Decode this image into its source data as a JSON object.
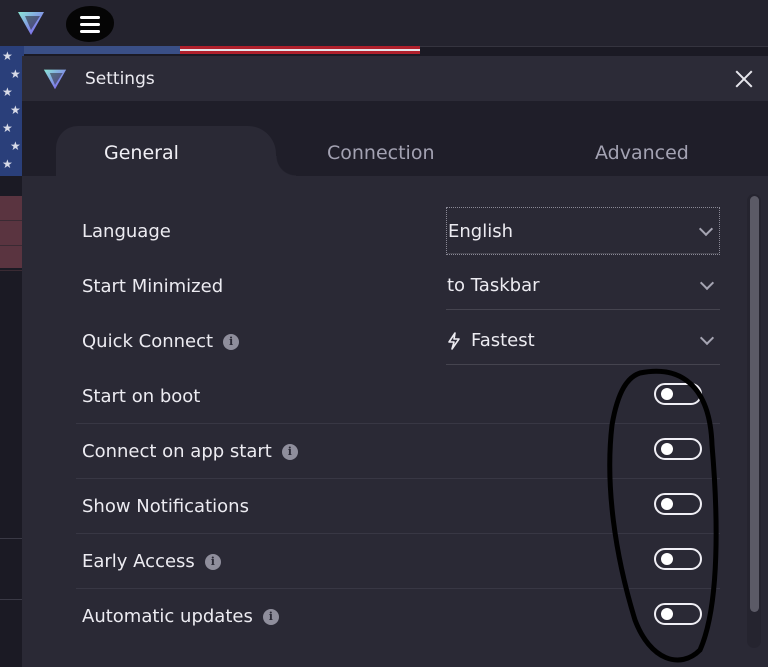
{
  "dialog": {
    "title": "Settings",
    "close_label": "×"
  },
  "tabs": [
    {
      "label": "General",
      "active": true
    },
    {
      "label": "Connection",
      "active": false
    },
    {
      "label": "Advanced",
      "active": false
    }
  ],
  "selects": {
    "language": {
      "label": "Language",
      "value": "English"
    },
    "start_minimized": {
      "label": "Start Minimized",
      "value": "to Taskbar"
    },
    "quick_connect": {
      "label": "Quick Connect",
      "value": "Fastest",
      "has_info": true,
      "value_icon": "lightning-icon"
    }
  },
  "toggles": [
    {
      "label": "Start on boot",
      "on": false,
      "has_info": false
    },
    {
      "label": "Connect on app start",
      "on": false,
      "has_info": true
    },
    {
      "label": "Show Notifications",
      "on": false,
      "has_info": false
    },
    {
      "label": "Early Access",
      "on": false,
      "has_info": true
    },
    {
      "label": "Automatic updates",
      "on": false,
      "has_info": true
    }
  ],
  "colors": {
    "dialog_bg": "#2a2935",
    "tabbar_bg": "#1f1e29",
    "text": "#ecebf1",
    "muted_tab": "#a3a2b2",
    "annotation": "#000000"
  }
}
